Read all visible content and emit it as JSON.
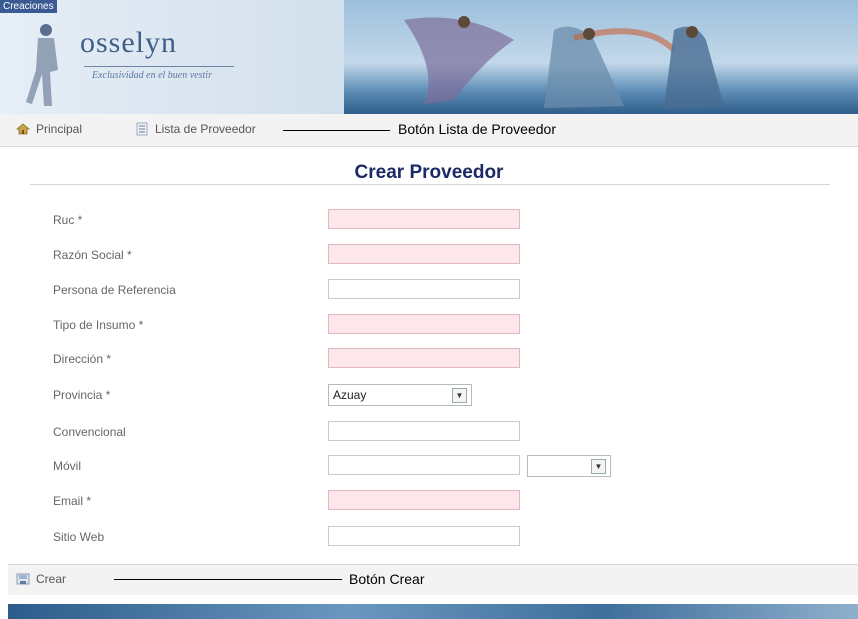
{
  "header": {
    "badge": "Creaciones",
    "logo_word": "osselyn",
    "tagline": "Exclusividad en el buen vestir"
  },
  "nav": {
    "items": [
      {
        "label": "Principal",
        "icon": "home-icon"
      },
      {
        "label": "Lista de Proveedor",
        "icon": "list-icon"
      }
    ],
    "annotation": "Botón Lista de Proveedor"
  },
  "form": {
    "title": "Crear Proveedor",
    "fields": [
      {
        "label": "Ruc *",
        "required": true
      },
      {
        "label": "Razón Social *",
        "required": true
      },
      {
        "label": "Persona de Referencia",
        "required": false
      },
      {
        "label": "Tipo de Insumo *",
        "required": true
      },
      {
        "label": "Dirección *",
        "required": true
      },
      {
        "label": "Provincia *",
        "required": true,
        "type": "select",
        "value": "Azuay"
      },
      {
        "label": "Convencional",
        "required": false
      },
      {
        "label": "Móvil",
        "required": false,
        "extra_select": ""
      },
      {
        "label": "Email *",
        "required": true
      },
      {
        "label": "Sitio Web",
        "required": false
      }
    ]
  },
  "footer": {
    "create_label": "Crear",
    "annotation": "Botón Crear"
  },
  "colors": {
    "title": "#1c2b66",
    "required_field_bg": "#fde7ea",
    "nav_bg": "#f3f3f3"
  }
}
